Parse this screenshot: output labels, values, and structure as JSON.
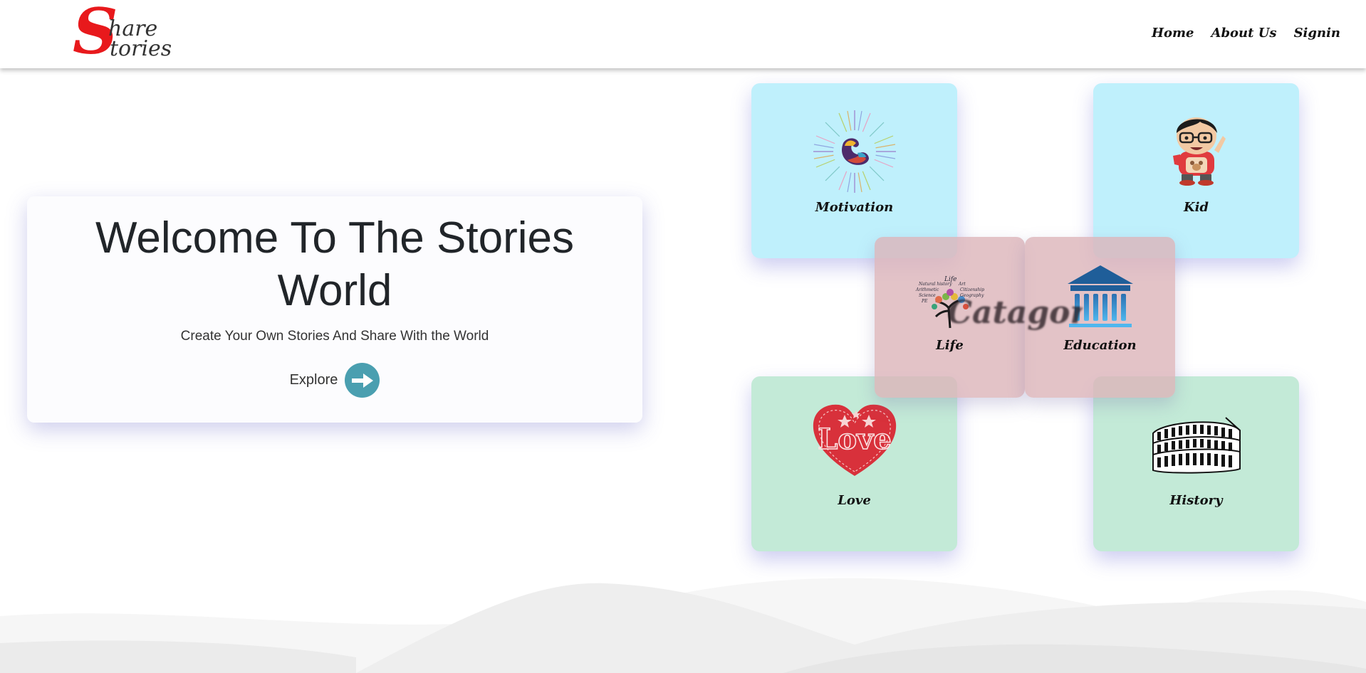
{
  "header": {
    "logo": {
      "letter": "S",
      "line1": "hare",
      "line2": "tories"
    },
    "nav": [
      {
        "label": "Home"
      },
      {
        "label": "About Us"
      },
      {
        "label": "Signin"
      }
    ]
  },
  "hero": {
    "title_line1": "Welcome To The Stories",
    "title_line2": "World",
    "subtitle": "Create Your Own Stories And Share With the World",
    "explore_label": "Explore"
  },
  "categories": {
    "title": "Catagories",
    "cards": [
      {
        "label": "Motivation",
        "color": "#bff0fc",
        "icon": "flexed-bicep-icon"
      },
      {
        "label": "Kid",
        "color": "#bff0fc",
        "icon": "cartoon-kid-icon"
      },
      {
        "label": "Life",
        "color": "#e7c3c8",
        "icon": "tree-wordcloud-icon",
        "icon_words": [
          "Life",
          "Natural history",
          "Art",
          "Citizenship",
          "Arithmetic",
          "Geography",
          "Science",
          "PE"
        ]
      },
      {
        "label": "Education",
        "color": "#e7c3c8",
        "icon": "institution-building-icon"
      },
      {
        "label": "Love",
        "color": "#c3ead7",
        "icon": "heart-love-icon",
        "icon_text": "Love"
      },
      {
        "label": "History",
        "color": "#c3ead7",
        "icon": "colosseum-icon"
      }
    ]
  }
}
